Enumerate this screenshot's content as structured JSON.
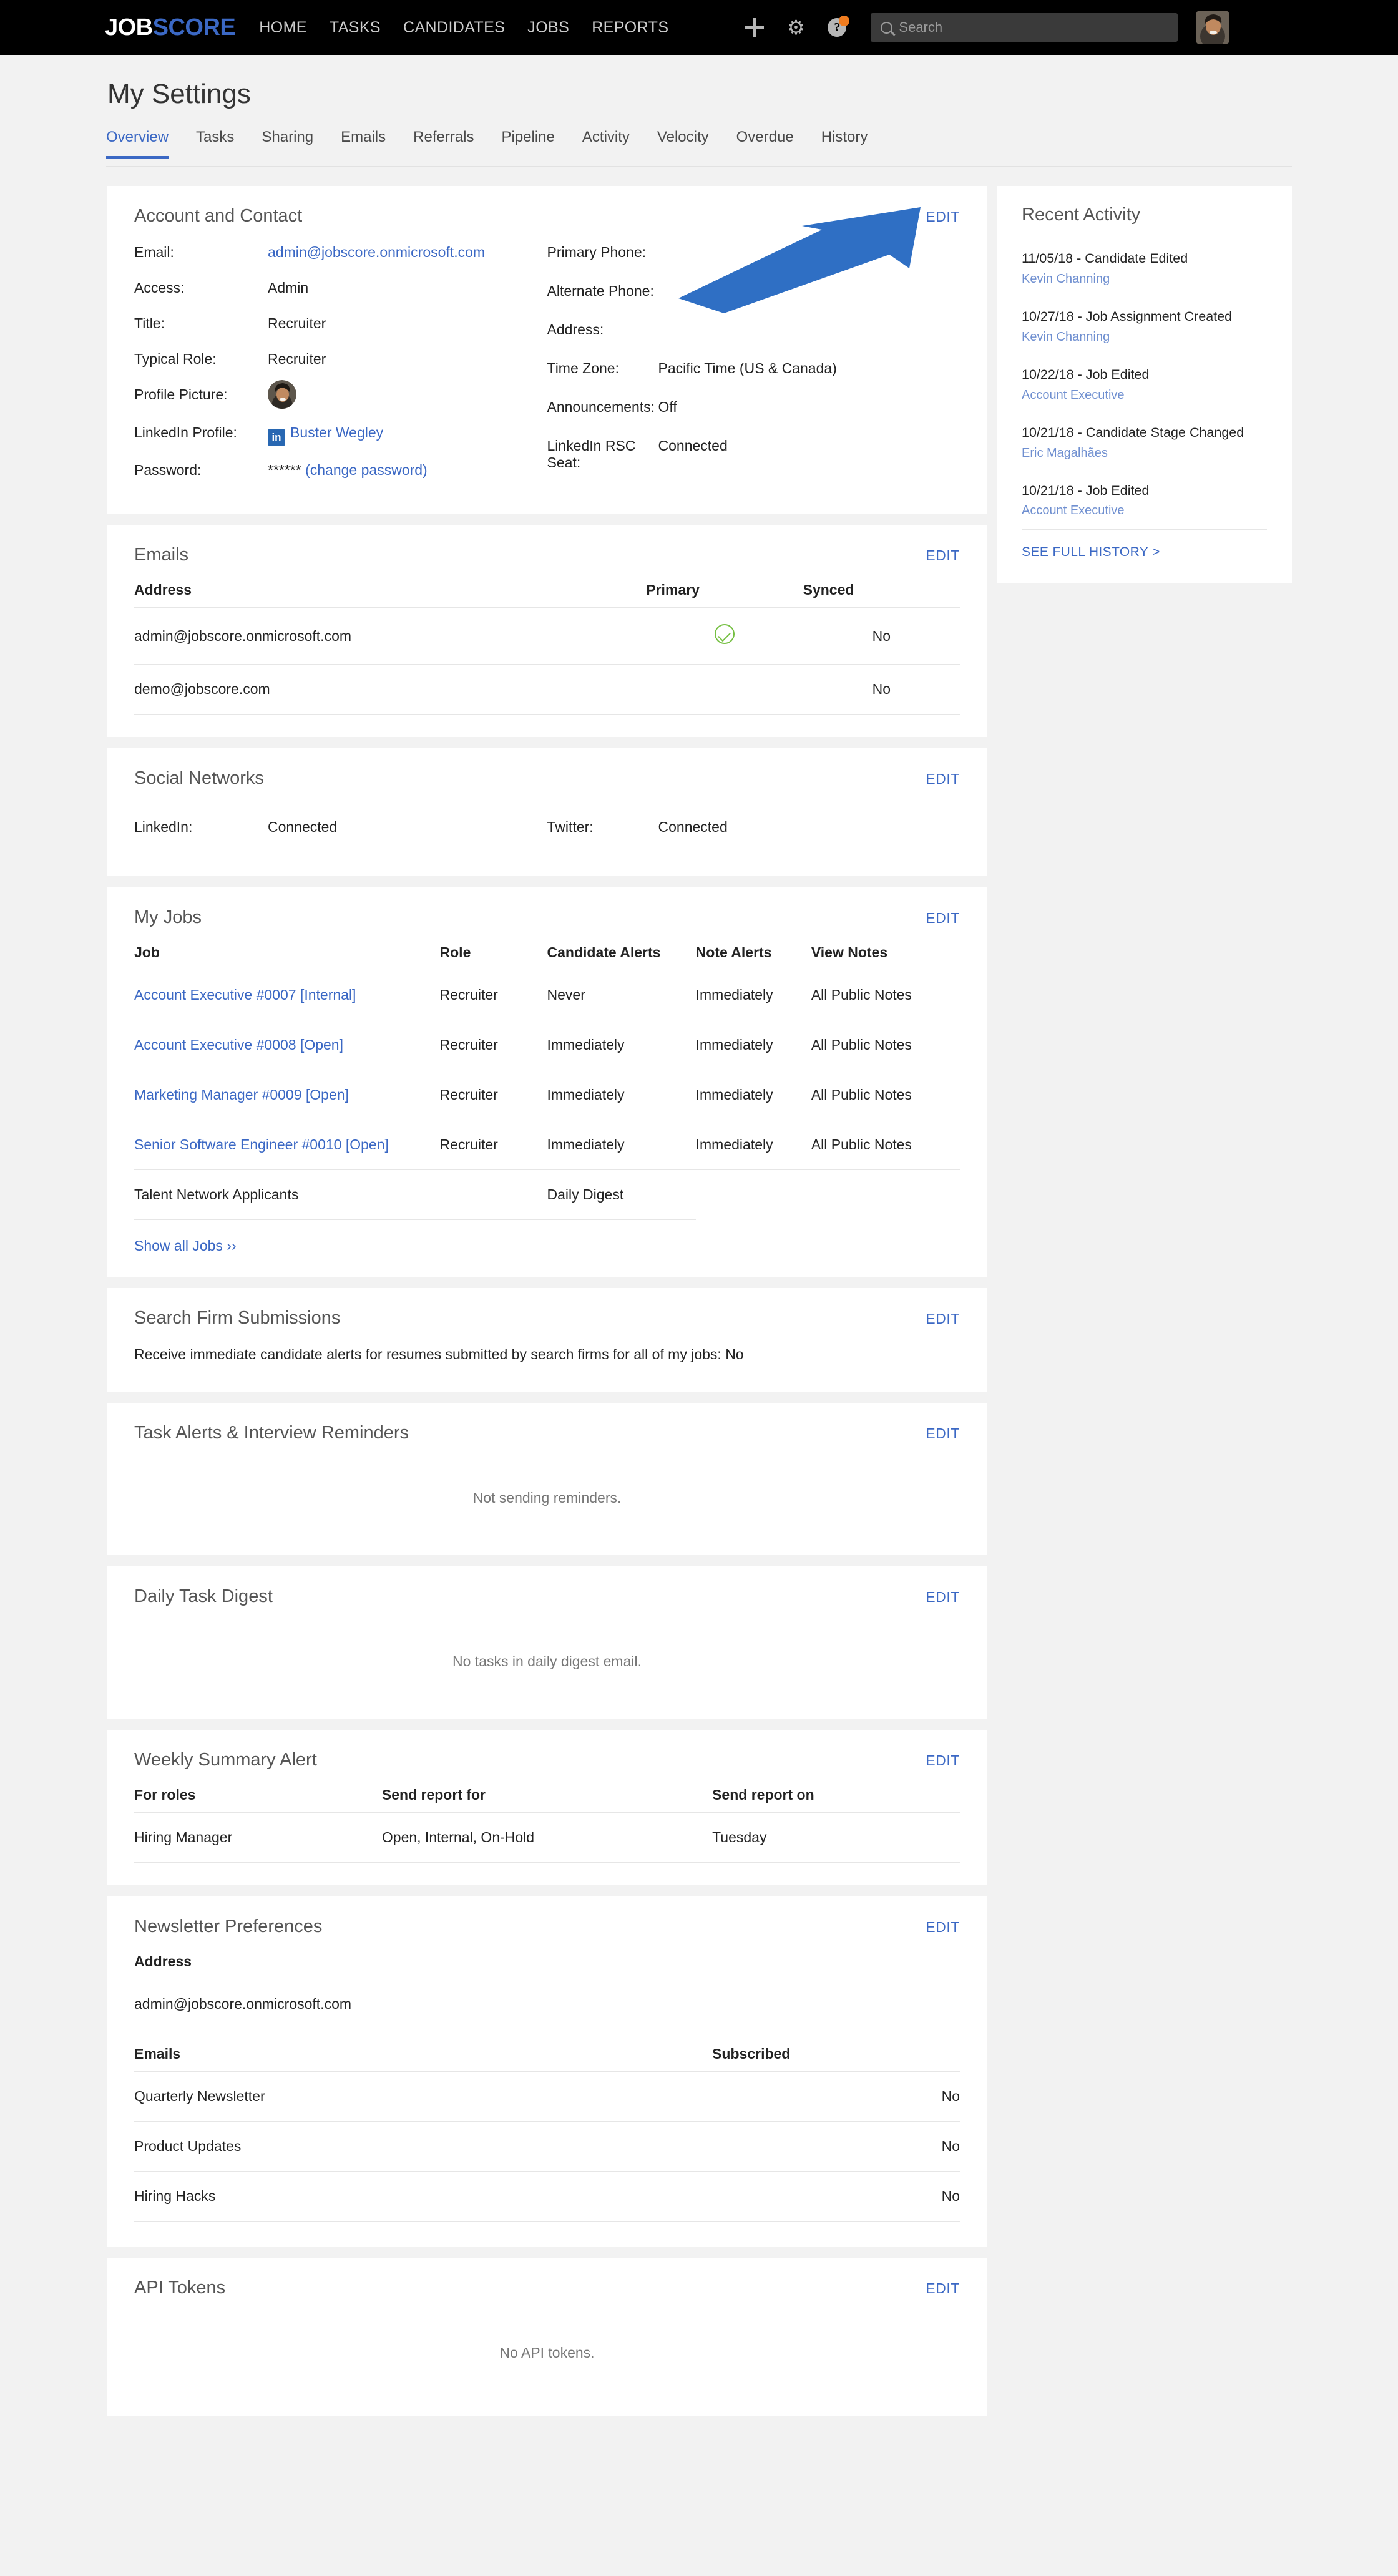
{
  "nav": {
    "logo_job": "JOB",
    "logo_score": "SCORE",
    "links": [
      "HOME",
      "TASKS",
      "CANDIDATES",
      "JOBS",
      "REPORTS"
    ],
    "icons": [
      "plus-icon",
      "gear-icon",
      "help-icon"
    ],
    "search_placeholder": "Search",
    "avatar": "user-avatar"
  },
  "page": {
    "title": "My Settings",
    "tabs": [
      {
        "label": "Overview",
        "active": true
      },
      {
        "label": "Tasks",
        "active": false
      },
      {
        "label": "Sharing",
        "active": false
      },
      {
        "label": "Emails",
        "active": false
      },
      {
        "label": "Referrals",
        "active": false
      },
      {
        "label": "Pipeline",
        "active": false
      },
      {
        "label": "Activity",
        "active": false
      },
      {
        "label": "Velocity",
        "active": false
      },
      {
        "label": "Overdue",
        "active": false
      },
      {
        "label": "History",
        "active": false
      }
    ]
  },
  "edit_label": "EDIT",
  "account": {
    "title": "Account and Contact",
    "left": [
      {
        "label": "Email:",
        "value": "admin@jobscore.onmicrosoft.com",
        "link": true
      },
      {
        "label": "Access:",
        "value": "Admin"
      },
      {
        "label": "Title:",
        "value": "Recruiter"
      },
      {
        "label": "Typical Role:",
        "value": "Recruiter"
      },
      {
        "label": "Profile Picture:",
        "value": ""
      },
      {
        "label": "LinkedIn Profile:",
        "value": "Buster Wegley",
        "link": true
      },
      {
        "label": "Password:",
        "value": "******",
        "action": "(change password)"
      }
    ],
    "right": [
      {
        "label": "Primary Phone:",
        "value": ""
      },
      {
        "label": "Alternate Phone:",
        "value": ""
      },
      {
        "label": "Address:",
        "value": ""
      },
      {
        "label": "Time Zone:",
        "value": "Pacific Time (US & Canada)"
      },
      {
        "label": "Announcements:",
        "value": "Off"
      },
      {
        "label": "LinkedIn RSC Seat:",
        "value": "Connected"
      }
    ]
  },
  "emails": {
    "title": "Emails",
    "columns": [
      "Address",
      "Primary",
      "Synced"
    ],
    "rows": [
      {
        "address": "admin@jobscore.onmicrosoft.com",
        "primary": true,
        "synced": "No"
      },
      {
        "address": "demo@jobscore.com",
        "primary": false,
        "synced": "No"
      }
    ]
  },
  "social": {
    "title": "Social Networks",
    "items": [
      {
        "label": "LinkedIn:",
        "value": "Connected"
      },
      {
        "label": "Twitter:",
        "value": "Connected"
      }
    ]
  },
  "my_jobs": {
    "title": "My Jobs",
    "columns": [
      "Job",
      "Role",
      "Candidate Alerts",
      "Note Alerts",
      "View Notes"
    ],
    "rows": [
      {
        "job": "Account Executive #0007 [Internal]",
        "link": true,
        "role": "Recruiter",
        "candidate_alerts": "Never",
        "note_alerts": "Immediately",
        "view_notes": "All Public Notes"
      },
      {
        "job": "Account Executive #0008 [Open]",
        "link": true,
        "role": "Recruiter",
        "candidate_alerts": "Immediately",
        "note_alerts": "Immediately",
        "view_notes": "All Public Notes"
      },
      {
        "job": "Marketing Manager #0009 [Open]",
        "link": true,
        "role": "Recruiter",
        "candidate_alerts": "Immediately",
        "note_alerts": "Immediately",
        "view_notes": "All Public Notes"
      },
      {
        "job": "Senior Software Engineer #0010 [Open]",
        "link": true,
        "role": "Recruiter",
        "candidate_alerts": "Immediately",
        "note_alerts": "Immediately",
        "view_notes": "All Public Notes"
      },
      {
        "job": "Talent Network Applicants",
        "link": false,
        "role": "",
        "candidate_alerts": "Daily Digest",
        "note_alerts": "",
        "view_notes": ""
      }
    ],
    "show_all": "Show all Jobs ››"
  },
  "search_firm": {
    "title": "Search Firm Submissions",
    "text": "Receive immediate candidate alerts for resumes submitted by search firms for all of my jobs: No"
  },
  "task_alerts": {
    "title": "Task Alerts & Interview Reminders",
    "empty": "Not sending reminders."
  },
  "daily_digest": {
    "title": "Daily Task Digest",
    "empty": "No tasks in daily digest email."
  },
  "weekly": {
    "title": "Weekly Summary Alert",
    "columns": [
      "For roles",
      "Send report for",
      "Send report on"
    ],
    "rows": [
      {
        "roles": "Hiring Manager",
        "report_for": "Open, Internal, On-Hold",
        "report_on": "Tuesday"
      }
    ]
  },
  "newsletter": {
    "title": "Newsletter Preferences",
    "address_header": "Address",
    "address": "admin@jobscore.onmicrosoft.com",
    "emails_header": "Emails",
    "subscribed_header": "Subscribed",
    "rows": [
      {
        "name": "Quarterly Newsletter",
        "subscribed": "No"
      },
      {
        "name": "Product Updates",
        "subscribed": "No"
      },
      {
        "name": "Hiring Hacks",
        "subscribed": "No"
      }
    ]
  },
  "api_tokens": {
    "title": "API Tokens",
    "empty": "No API tokens."
  },
  "recent_activity": {
    "title": "Recent Activity",
    "items": [
      {
        "main": "11/05/18 - Candidate Edited",
        "sub": "Kevin Channing"
      },
      {
        "main": "10/27/18 - Job Assignment Created",
        "sub": "Kevin Channing"
      },
      {
        "main": "10/22/18 - Job Edited",
        "sub": "Account Executive"
      },
      {
        "main": "10/21/18 - Candidate Stage Changed",
        "sub": "Eric Magalhães"
      },
      {
        "main": "10/21/18 - Job Edited",
        "sub": "Account Executive"
      }
    ],
    "see_full": "SEE FULL HISTORY >"
  },
  "annotation": {
    "shape": "arrow-pointing-to-edit",
    "color": "#2f6fc4"
  }
}
